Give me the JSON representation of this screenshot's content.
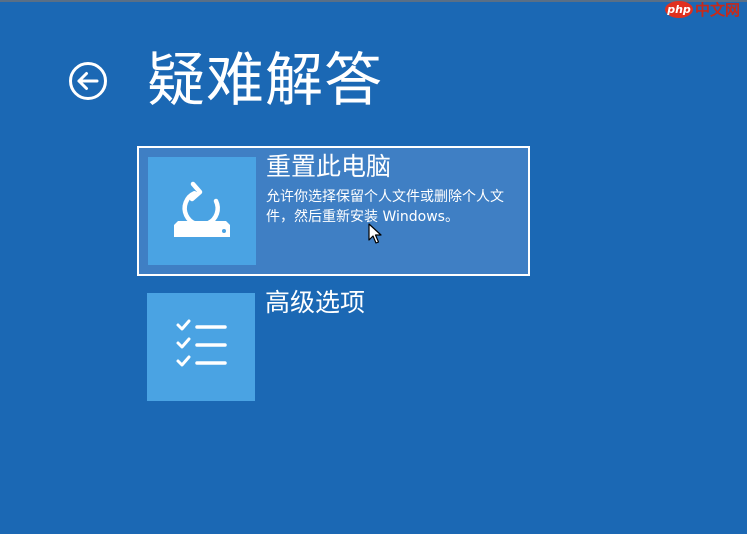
{
  "page": {
    "title": "疑难解答"
  },
  "icons": {
    "back": "back-arrow-circle-icon",
    "reset": "reset-pc-icon",
    "advanced": "checklist-icon",
    "cursor": "mouse-pointer-icon"
  },
  "options": [
    {
      "title": "重置此电脑",
      "description": "允许你选择保留个人文件或删除个人文件，然后重新安装 Windows。",
      "selected": true
    },
    {
      "title": "高级选项",
      "description": "",
      "selected": false
    }
  ],
  "watermark": {
    "badge": "php",
    "text": "中文网"
  },
  "colors": {
    "background": "#1b68b4",
    "tile": "#4aa3e3",
    "selected_background": "#3f7fc4",
    "selected_border": "#ffffff"
  }
}
